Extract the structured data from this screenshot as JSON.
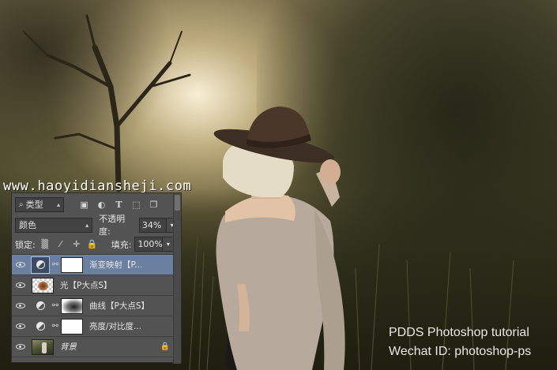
{
  "watermark_top": "www.haoyidiansheji.com",
  "watermark_bottom": {
    "line1": "PDDS Photoshop tutorial",
    "line2": "Wechat ID: photoshop-ps"
  },
  "layers_panel": {
    "filter_kind": "类型",
    "filter_icons": [
      "image-filter-icon",
      "adjustment-filter-icon",
      "type-filter-icon",
      "shape-filter-icon",
      "smart-object-filter-icon"
    ],
    "blend_mode": "颜色",
    "opacity_label": "不透明度:",
    "opacity_value": "34%",
    "lock_label": "锁定:",
    "lock_icons": [
      "lock-transparent-icon",
      "lock-pixels-icon",
      "lock-position-icon",
      "lock-all-icon"
    ],
    "fill_label": "填充:",
    "fill_value": "100%",
    "layers": [
      {
        "name": "渐变映射【P...",
        "type": "adjustment",
        "selected": true
      },
      {
        "name": "光【P大点S】",
        "type": "pixel",
        "selected": false
      },
      {
        "name": "曲线【P大点S】",
        "type": "curves",
        "selected": false
      },
      {
        "name": "亮度/对比度...",
        "type": "adjustment",
        "selected": false
      },
      {
        "name": "背景",
        "type": "background",
        "selected": false
      }
    ]
  },
  "colors": {
    "panel_bg": "#535353",
    "selected_layer": "#6b7fa0"
  }
}
